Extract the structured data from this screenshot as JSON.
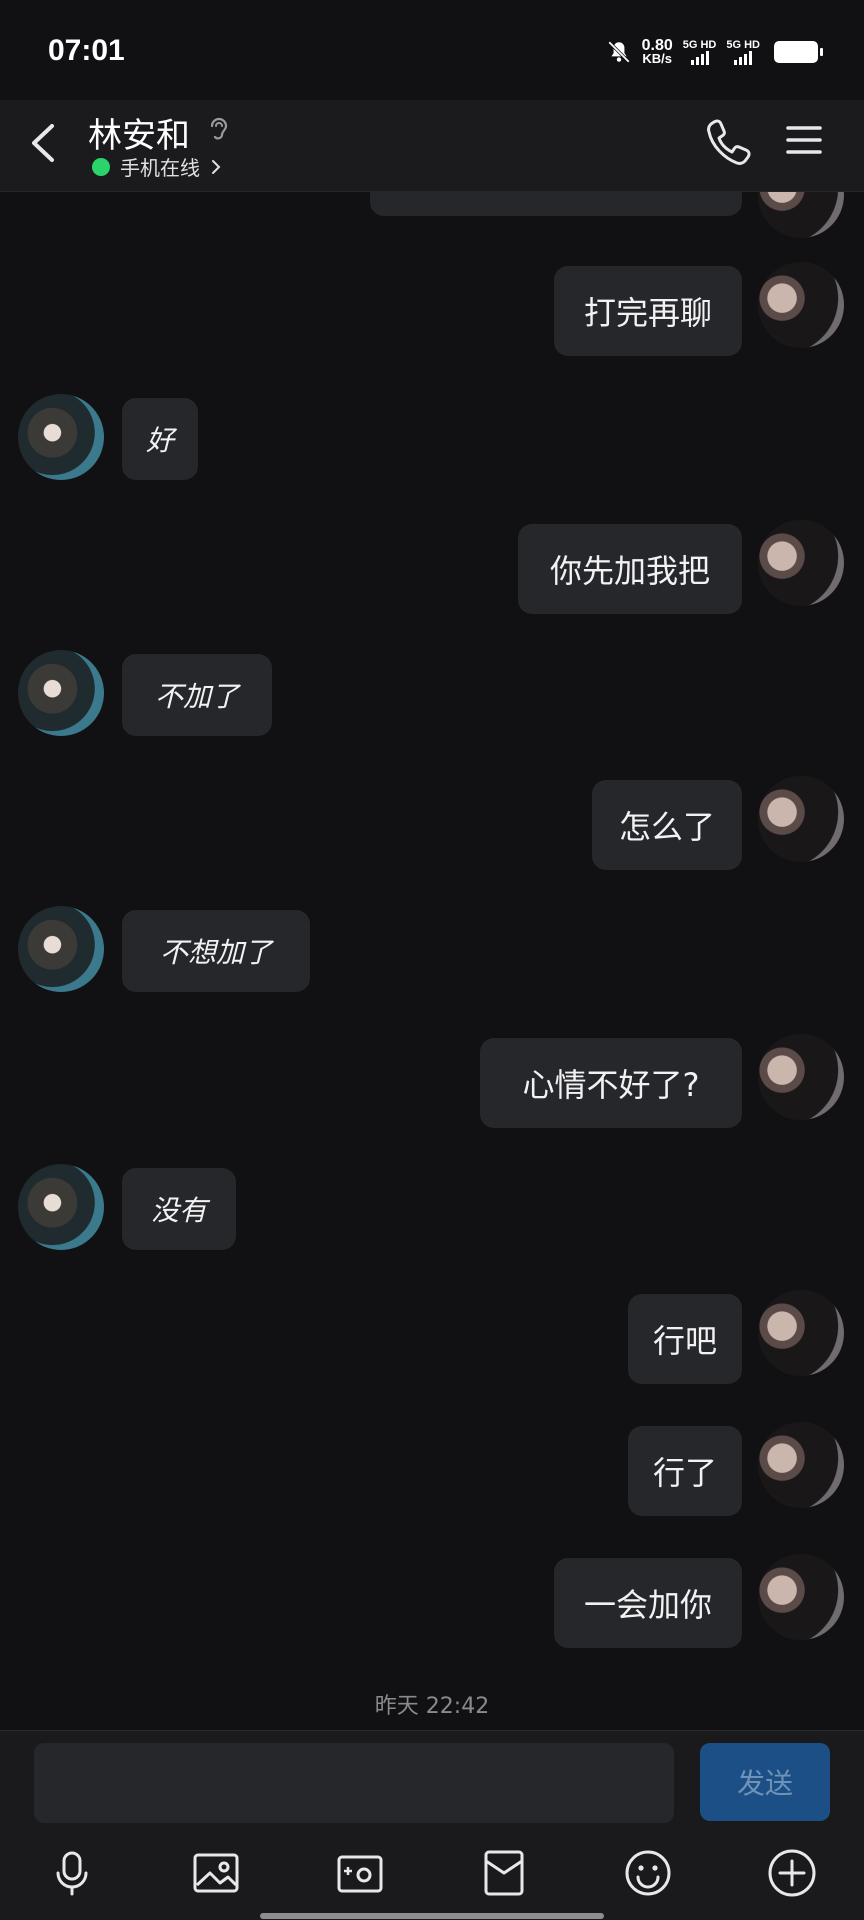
{
  "status_bar": {
    "time": "07:01",
    "net_speed_value": "0.80",
    "net_speed_unit": "KB/s",
    "sim1_label": "5G HD",
    "sim2_label": "5G HD",
    "icons": [
      "mute-bell-icon",
      "signal-icon",
      "signal-icon",
      "battery-icon"
    ]
  },
  "header": {
    "contact_name": "林安和",
    "online_status": "手机在线",
    "icons": [
      "back-icon",
      "ear-icon",
      "phone-icon",
      "menu-icon"
    ]
  },
  "messages": [
    {
      "from": "me",
      "text": "打完再聊"
    },
    {
      "from": "them",
      "text": "好"
    },
    {
      "from": "me",
      "text": "你先加我把"
    },
    {
      "from": "them",
      "text": "不加了"
    },
    {
      "from": "me",
      "text": "怎么了"
    },
    {
      "from": "them",
      "text": "不想加了"
    },
    {
      "from": "me",
      "text": "心情不好了?"
    },
    {
      "from": "them",
      "text": "没有"
    },
    {
      "from": "me",
      "text": "行吧"
    },
    {
      "from": "me",
      "text": "行了"
    },
    {
      "from": "me",
      "text": "一会加你"
    }
  ],
  "timestamp": "昨天 22:42",
  "composer": {
    "input_value": "",
    "send_label": "发送"
  },
  "toolbar": {
    "icons": [
      "microphone-icon",
      "image-icon",
      "camera-icon",
      "red-packet-icon",
      "emoji-icon",
      "plus-icon"
    ]
  },
  "colors": {
    "background": "#111113",
    "bubble": "#26272b",
    "online": "#2bd46b",
    "send_button": "#1b4f86"
  }
}
